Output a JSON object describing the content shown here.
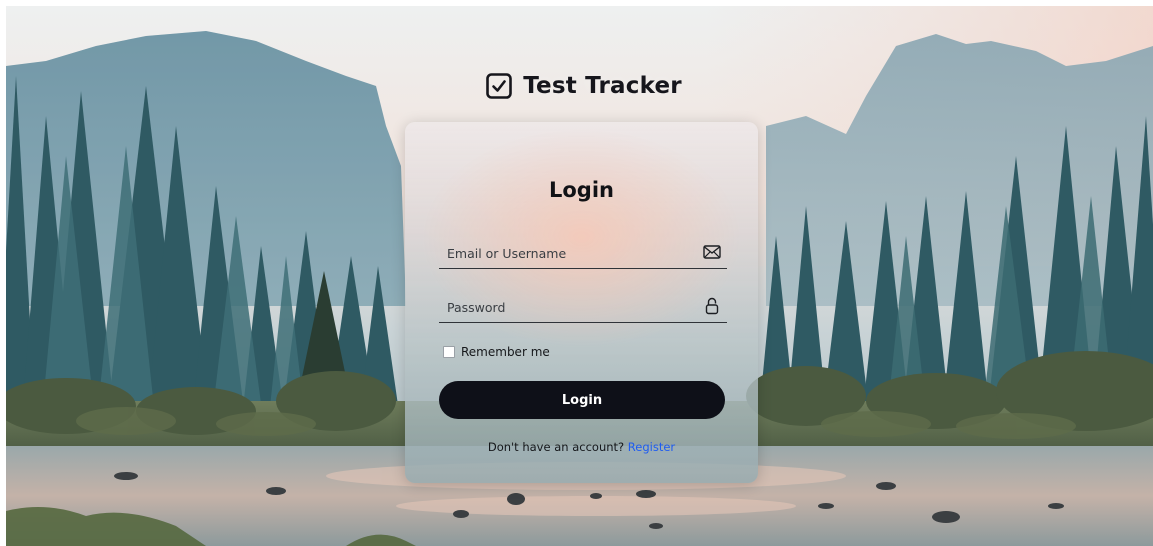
{
  "brand": {
    "title": "Test Tracker",
    "icon": "checkbox-check-icon"
  },
  "login": {
    "title": "Login",
    "email_placeholder": "Email or Username",
    "email_icon": "envelope-icon",
    "password_placeholder": "Password",
    "password_icon": "lock-icon",
    "remember_label": "Remember me",
    "remember_checked": false,
    "submit_label": "Login",
    "register_prompt": "Don't have an account?",
    "register_link": "Register"
  },
  "colors": {
    "button_bg": "#0e1018",
    "link": "#1f5cf0",
    "text_dark": "#111216"
  }
}
